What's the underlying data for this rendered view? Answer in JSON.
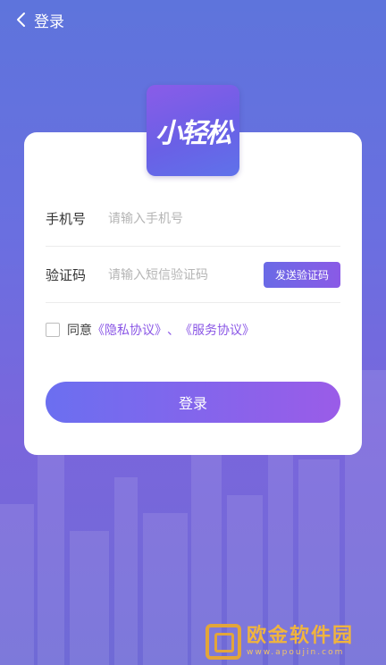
{
  "header": {
    "back_icon": "chevron-left-icon",
    "title": "登录"
  },
  "logo": {
    "text": "小轻松"
  },
  "form": {
    "phone": {
      "label": "手机号",
      "placeholder": "请输入手机号",
      "value": ""
    },
    "code": {
      "label": "验证码",
      "placeholder": "请输入短信验证码",
      "value": "",
      "send_button": "发送验证码"
    },
    "agreement": {
      "checked": false,
      "prefix": "同意",
      "privacy_link": "《隐私协议》",
      "separator": "、",
      "service_link": "《服务协议》"
    },
    "login_button": "登录"
  },
  "watermark": {
    "text": "欧金软件园",
    "sub": "www.apoujin.com"
  },
  "colors": {
    "accent": "#8a56e6",
    "button_start": "#6b6ff0",
    "button_end": "#9a5ce8",
    "background": "#6a6fe0"
  }
}
